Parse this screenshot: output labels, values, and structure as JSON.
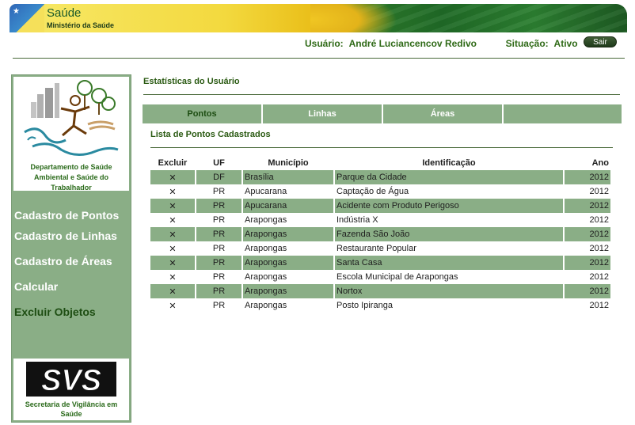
{
  "header": {
    "brand": "Saúde",
    "brand_sub": "Ministério da Saúde"
  },
  "userbar": {
    "user_label": "Usuário:",
    "user_name": "André Luciancencov Redivo",
    "status_label": "Situação:",
    "status_value": "Ativo",
    "logout_label": "Sair"
  },
  "sidebar": {
    "logo_caption_line1": "Departamento de Saúde",
    "logo_caption_line2": "Ambiental e Saúde do",
    "logo_caption_line3": "Trabalhador",
    "items": [
      {
        "label": "Cadastro de Pontos"
      },
      {
        "label": "Cadastro de Linhas"
      },
      {
        "label": "Cadastro de Áreas"
      },
      {
        "label": "Calcular"
      },
      {
        "label": "Excluir Objetos"
      }
    ],
    "svs_logo_text": "SVS",
    "svs_caption_line1": "Secretaria de Vigilância em",
    "svs_caption_line2": "Saúde"
  },
  "main": {
    "title": "Estatísticas do Usuário",
    "tabs": [
      {
        "label": "Pontos"
      },
      {
        "label": "Linhas"
      },
      {
        "label": "Áreas"
      },
      {
        "label": ""
      }
    ],
    "list_title": "Lista de Pontos Cadastrados",
    "columns": {
      "excluir": "Excluir",
      "uf": "UF",
      "municipio": "Município",
      "identificacao": "Identificação",
      "ano": "Ano"
    },
    "rows": [
      {
        "uf": "DF",
        "municipio": "Brasília",
        "identificacao": "Parque da Cidade",
        "ano": "2012"
      },
      {
        "uf": "PR",
        "municipio": "Apucarana",
        "identificacao": "Captação de Água",
        "ano": "2012"
      },
      {
        "uf": "PR",
        "municipio": "Apucarana",
        "identificacao": "Acidente com Produto Perigoso",
        "ano": "2012"
      },
      {
        "uf": "PR",
        "municipio": "Arapongas",
        "identificacao": "Indústria X",
        "ano": "2012"
      },
      {
        "uf": "PR",
        "municipio": "Arapongas",
        "identificacao": "Fazenda São João",
        "ano": "2012"
      },
      {
        "uf": "PR",
        "municipio": "Arapongas",
        "identificacao": "Restaurante Popular",
        "ano": "2012"
      },
      {
        "uf": "PR",
        "municipio": "Arapongas",
        "identificacao": "Santa Casa",
        "ano": "2012"
      },
      {
        "uf": "PR",
        "municipio": "Arapongas",
        "identificacao": "Escola Municipal de Arapongas",
        "ano": "2012"
      },
      {
        "uf": "PR",
        "municipio": "Arapongas",
        "identificacao": "Nortox",
        "ano": "2012"
      },
      {
        "uf": "PR",
        "municipio": "Arapongas",
        "identificacao": "Posto Ipiranga",
        "ano": "2012"
      }
    ],
    "delete_icon": "x-icon"
  },
  "colors": {
    "accent_green": "#8aae86",
    "text_green": "#2f6a17",
    "dark_green": "#1d4d12"
  }
}
